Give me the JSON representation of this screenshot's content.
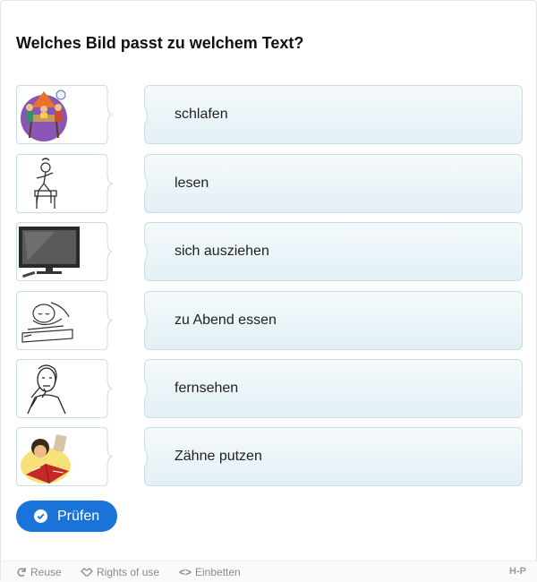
{
  "question": "Welches Bild passt zu welchem Text?",
  "rows": [
    {
      "image": "family-dinner-image",
      "text": "schlafen"
    },
    {
      "image": "person-stretching-image",
      "text": "lesen"
    },
    {
      "image": "television-image",
      "text": "sich ausziehen"
    },
    {
      "image": "sleeping-person-image",
      "text": "zu Abend essen"
    },
    {
      "image": "brushing-teeth-image",
      "text": "fernsehen"
    },
    {
      "image": "reading-boy-image",
      "text": "Zähne putzen"
    }
  ],
  "check_button": {
    "label": "Prüfen",
    "icon": "check-circle-icon"
  },
  "footer": {
    "reuse": "Reuse",
    "rights": "Rights of use",
    "embed": "Einbetten",
    "brand": "H-P"
  },
  "colors": {
    "accent": "#1a73d9",
    "card_border": "#c9dde6"
  }
}
